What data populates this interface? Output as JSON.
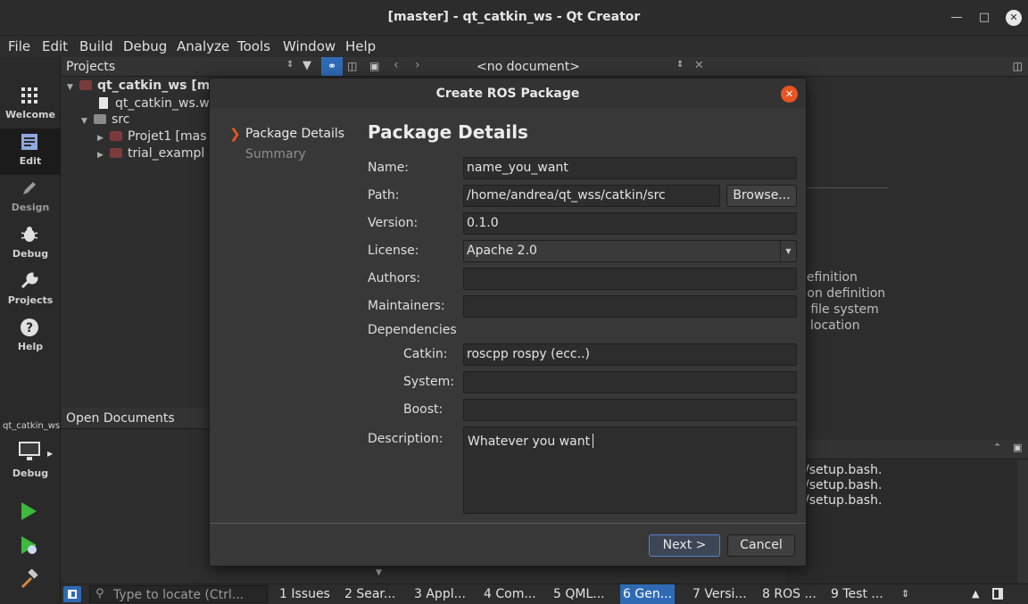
{
  "window": {
    "title": "[master] - qt_catkin_ws - Qt Creator"
  },
  "menu": [
    "File",
    "Edit",
    "Build",
    "Debug",
    "Analyze",
    "Tools",
    "Window",
    "Help"
  ],
  "modes": [
    {
      "label": "Welcome",
      "icon": "grid-icon"
    },
    {
      "label": "Edit",
      "icon": "document-icon"
    },
    {
      "label": "Design",
      "icon": "pencil-icon"
    },
    {
      "label": "Debug",
      "icon": "bug-icon"
    },
    {
      "label": "Projects",
      "icon": "wrench-icon"
    },
    {
      "label": "Help",
      "icon": "help-icon"
    }
  ],
  "kit": {
    "project": "qt_catkin_ws",
    "config": "Debug"
  },
  "projects_pane": {
    "title": "Projects",
    "tree": [
      {
        "label": "qt_catkin_ws [ma",
        "level": 0
      },
      {
        "label": "qt_catkin_ws.w",
        "level": 1
      },
      {
        "label": "src",
        "level": 0
      },
      {
        "label": "Projet1 [mas",
        "level": 1
      },
      {
        "label": "trial_exampl",
        "level": 1
      }
    ]
  },
  "open_documents": {
    "title": "Open Documents"
  },
  "editor_toolbar": {
    "document": "<no document>"
  },
  "editor_text": [
    " definition",
    "tion definition",
    "n file system",
    "a location"
  ],
  "output_lines": [
    "/setup.bash.",
    "/setup.bash.",
    "/setup.bash."
  ],
  "dialog": {
    "title": "Create ROS Package",
    "steps": [
      "Package Details",
      "Summary"
    ],
    "page_title": "Package Details",
    "fields": {
      "name": {
        "label": "Name:",
        "value": "name_you_want"
      },
      "path": {
        "label": "Path:",
        "value": "/home/andrea/qt_wss/catkin/src",
        "button": "Browse..."
      },
      "version": {
        "label": "Version:",
        "value": "0.1.0"
      },
      "license": {
        "label": "License:",
        "value": "Apache 2.0"
      },
      "authors": {
        "label": "Authors:",
        "value": ""
      },
      "maintainers": {
        "label": "Maintainers:",
        "value": ""
      },
      "dependencies": {
        "label": "Dependencies"
      },
      "catkin": {
        "label": "Catkin:",
        "value": "roscpp rospy (ecc..)"
      },
      "system": {
        "label": "System:",
        "value": ""
      },
      "boost": {
        "label": "Boost:",
        "value": ""
      },
      "description": {
        "label": "Description:",
        "value": "Whatever you want"
      }
    },
    "buttons": {
      "next": "Next >",
      "cancel": "Cancel"
    }
  },
  "statusbar": {
    "locator_placeholder": "Type to locate (Ctrl...",
    "tabs": [
      "1 Issues",
      "2 Sear...",
      "3 Appl...",
      "4 Com...",
      "5 QML...",
      "6 Gen...",
      "7 Versi...",
      "8 ROS ...",
      "9 Test ..."
    ]
  },
  "colors": {
    "accent": "#e95420",
    "selection": "#2f6bb5",
    "background": "#2d2d2d"
  }
}
